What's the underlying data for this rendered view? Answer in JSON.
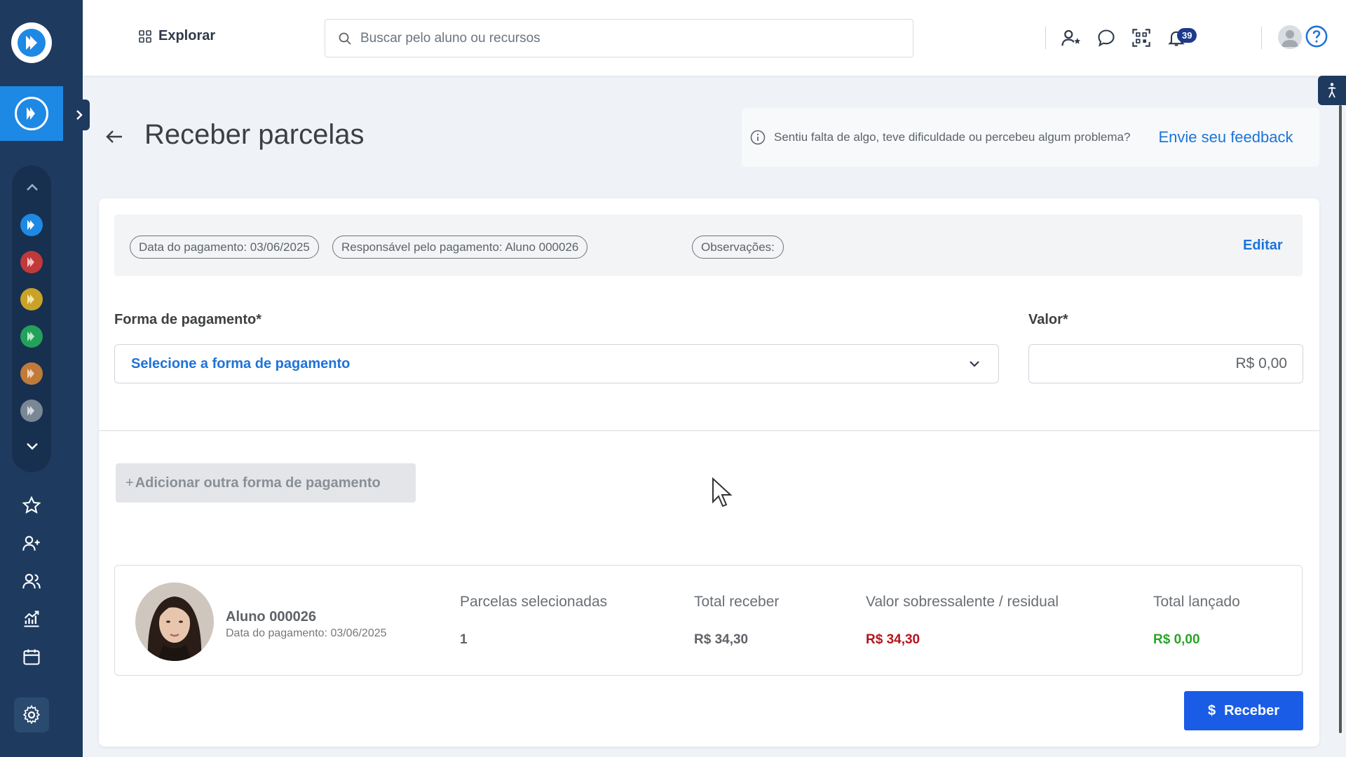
{
  "header": {
    "explore_label": "Explorar",
    "search_placeholder": "Buscar pelo aluno ou recursos",
    "notification_count": "39"
  },
  "page": {
    "title": "Receber parcelas",
    "feedback_text": "Sentiu falta de algo, teve dificuldade ou percebeu algum problema?",
    "feedback_link": "Envie seu feedback"
  },
  "chips": {
    "payment_date": "Data do pagamento: 03/06/2025",
    "responsible": "Responsável pelo pagamento: Aluno 000026",
    "observations": "Observações:",
    "edit_label": "Editar"
  },
  "form": {
    "payment_method_label": "Forma de pagamento*",
    "payment_method_placeholder": "Selecione a forma de pagamento",
    "value_label": "Valor*",
    "value": "R$ 0,00",
    "add_method_label": "Adicionar outra forma de pagamento"
  },
  "summary": {
    "student_name": "Aluno 000026",
    "student_date": "Data do pagamento: 03/06/2025",
    "selected_head": "Parcelas selecionadas",
    "selected_value": "1",
    "total_head": "Total receber",
    "total_value": "R$ 34,30",
    "residual_head": "Valor sobressalente / residual",
    "residual_value": "R$ 34,30",
    "launched_head": "Total lançado",
    "launched_value": "R$ 0,00"
  },
  "actions": {
    "receive_label": "Receber"
  },
  "colors": {
    "sidebar": "#1e3a5f",
    "accent": "#1e73d8",
    "primary_button": "#1a5ce6",
    "negative": "#b3141e",
    "positive": "#2aa32a"
  },
  "icons": {
    "unit_dots": [
      "#1e88e5",
      "#c0393b",
      "#c9a227",
      "#23a05a",
      "#c07a3a",
      "#7a8794"
    ]
  }
}
